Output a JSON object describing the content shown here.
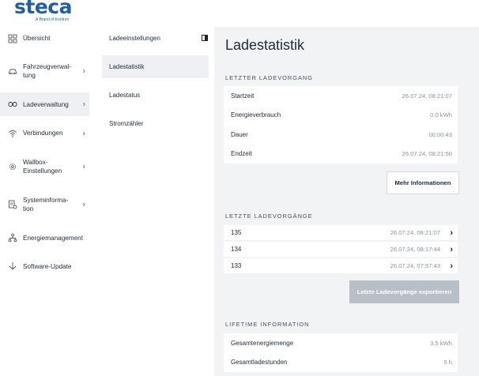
{
  "brand": {
    "name": "steca",
    "tagline": "A Brand of Kontron",
    "color": "#1f5fa8"
  },
  "nav": {
    "items": [
      {
        "label": "Übersicht",
        "icon": "dashboard-icon",
        "chevron": false,
        "active": false
      },
      {
        "label": "Fahrzeugverwal-tung",
        "icon": "car-icon",
        "chevron": true,
        "active": false
      },
      {
        "label": "Ladeverwaltung",
        "icon": "charging-icon",
        "chevron": true,
        "active": true
      },
      {
        "label": "Verbindungen",
        "icon": "wifi-icon",
        "chevron": true,
        "active": false
      },
      {
        "label": "Wallbox-Einstellungen",
        "icon": "gear-icon",
        "chevron": true,
        "active": false
      },
      {
        "label": "Systeminforma-tion",
        "icon": "system-info-icon",
        "chevron": true,
        "active": false
      },
      {
        "label": "Energiemanagement",
        "icon": "network-icon",
        "chevron": false,
        "active": false
      },
      {
        "label": "Software-Update",
        "icon": "download-icon",
        "chevron": false,
        "active": false
      }
    ]
  },
  "subnav": {
    "items": [
      {
        "label": "Ladeeinstellungen",
        "active": false
      },
      {
        "label": "Ladestatistik",
        "active": true
      },
      {
        "label": "Ladestatus",
        "active": false
      },
      {
        "label": "Stromzähler",
        "active": false
      }
    ]
  },
  "main": {
    "title": "Ladestatistik",
    "last_session": {
      "heading": "LETZTER LADEVORGANG",
      "rows": [
        {
          "label": "Startzeit",
          "value": "26.07.24, 08:21:07"
        },
        {
          "label": "Energieverbrauch",
          "value": "0.0 kWh"
        },
        {
          "label": "Dauer",
          "value": "00:00:43"
        },
        {
          "label": "Endzeit",
          "value": "26.07.24, 08:21:50"
        }
      ],
      "more_button": "Mehr Informationen"
    },
    "sessions": {
      "heading": "LETZTE LADEVORGÄNGE",
      "rows": [
        {
          "id": "135",
          "timestamp": "26.07.24, 08:21:07"
        },
        {
          "id": "134",
          "timestamp": "26.07.24, 08:17:44"
        },
        {
          "id": "133",
          "timestamp": "26.07.24, 07:57:43"
        }
      ],
      "export_button": "Letzte Ladevorgänge exportieren"
    },
    "lifetime": {
      "heading": "LIFETIME INFORMATION",
      "rows": [
        {
          "label": "Gesamtenergiemenge",
          "value": "3.5 kWh"
        },
        {
          "label": "Gesamtladestunden",
          "value": "5 h"
        }
      ]
    }
  }
}
